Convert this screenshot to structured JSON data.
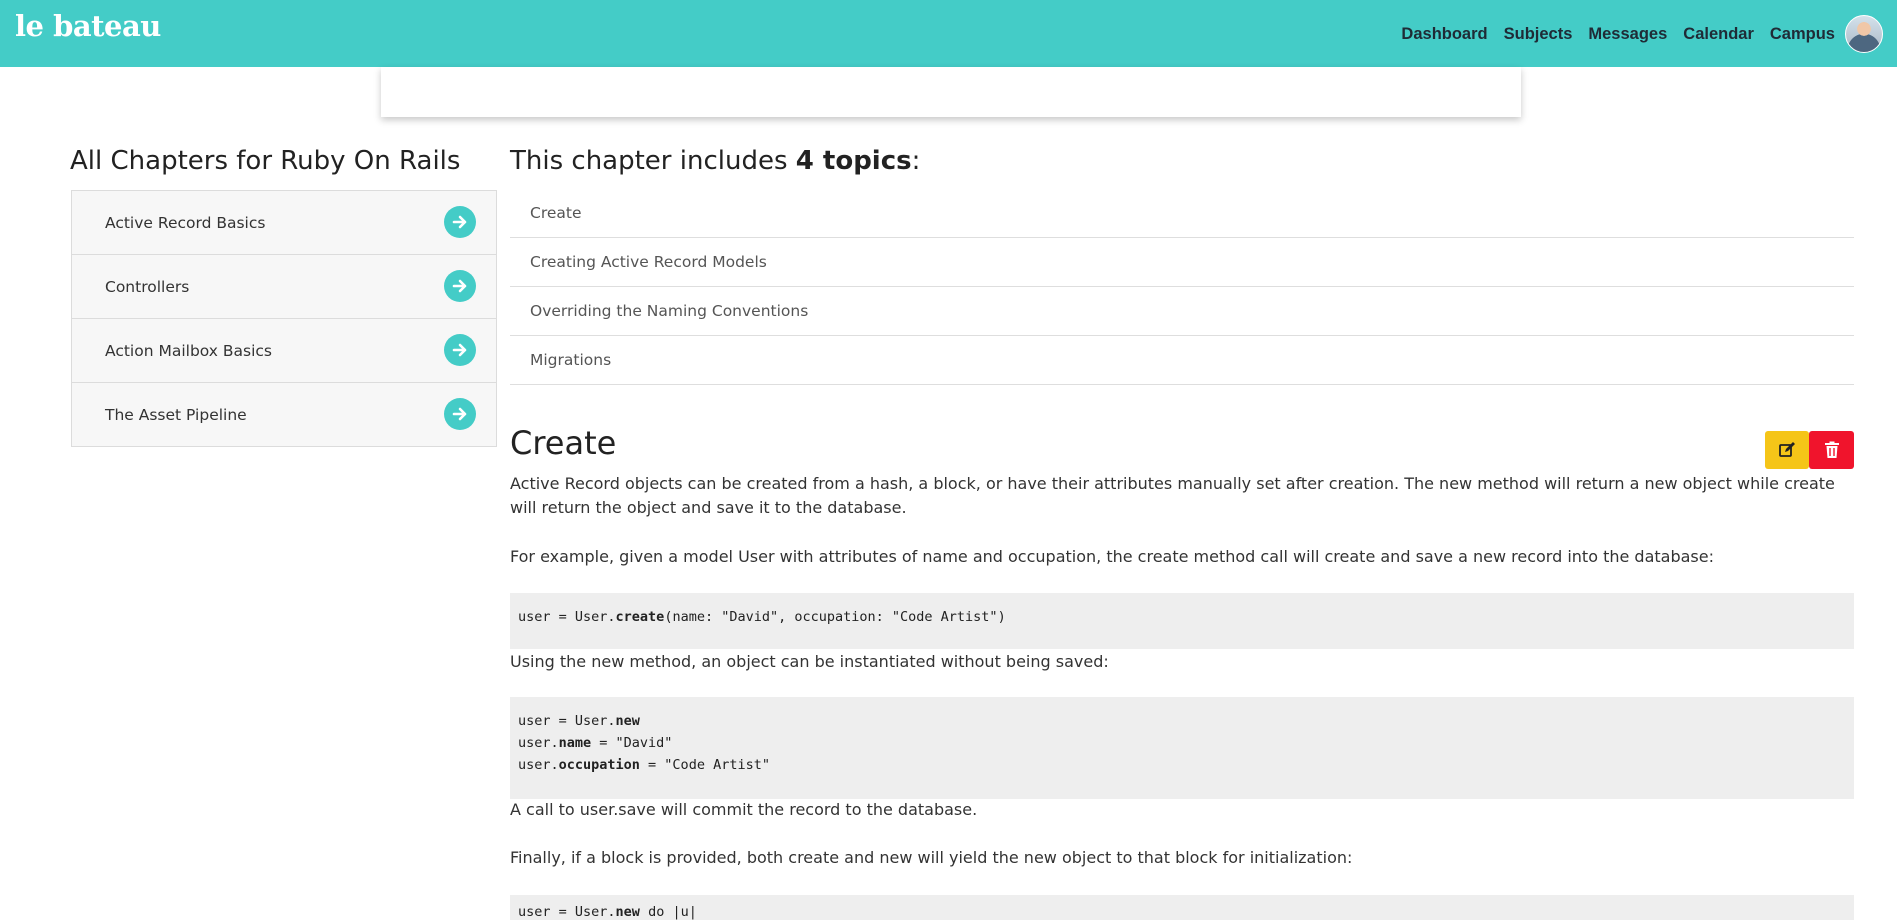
{
  "nav": {
    "brand": "le bateau",
    "links": [
      "Dashboard",
      "Subjects",
      "Messages",
      "Calendar",
      "Campus"
    ]
  },
  "sidebar": {
    "title": "All Chapters for Ruby On Rails",
    "chapters": [
      "Active Record Basics",
      "Controllers",
      "Action Mailbox Basics",
      "The Asset Pipeline"
    ]
  },
  "topics": {
    "heading_prefix": "This chapter includes ",
    "count_label": "4 topics",
    "heading_suffix": ":",
    "items": [
      "Create",
      "Creating Active Record Models",
      "Overriding the Naming Conventions",
      "Migrations"
    ]
  },
  "section": {
    "title": "Create",
    "p1": "Active Record objects can be created from a hash, a block, or have their attributes manually set after creation. The new method will return a new object while create will return the object and save it to the database.",
    "p2": "For example, given a model User with attributes of name and occupation, the create method call will create and save a new record into the database:",
    "code1": {
      "a": "user = User.",
      "b": "create",
      "c": "(name: \"David\", occupation: \"Code Artist\")"
    },
    "p3": "Using the new method, an object can be instantiated without being saved:",
    "code2": {
      "l1a": "user = User.",
      "l1b": "new",
      "l2a": "user.",
      "l2b": "name",
      "l2c": " = \"David\"",
      "l3a": "user.",
      "l3b": "occupation",
      "l3c": " = \"Code Artist\""
    },
    "p4": "A call to user.save will commit the record to the database.",
    "p5": "Finally, if a block is provided, both create and new will yield the new object to that block for initialization:",
    "code3": {
      "a": "user = User.",
      "b": "new",
      "c": " do |u|"
    }
  },
  "colors": {
    "brand": "#44ccc7",
    "edit": "#f5c518",
    "delete": "#f0142c"
  },
  "icons": {
    "chapter_arrow": "arrow-right-circle-icon",
    "edit": "edit-icon",
    "delete": "trash-icon"
  }
}
